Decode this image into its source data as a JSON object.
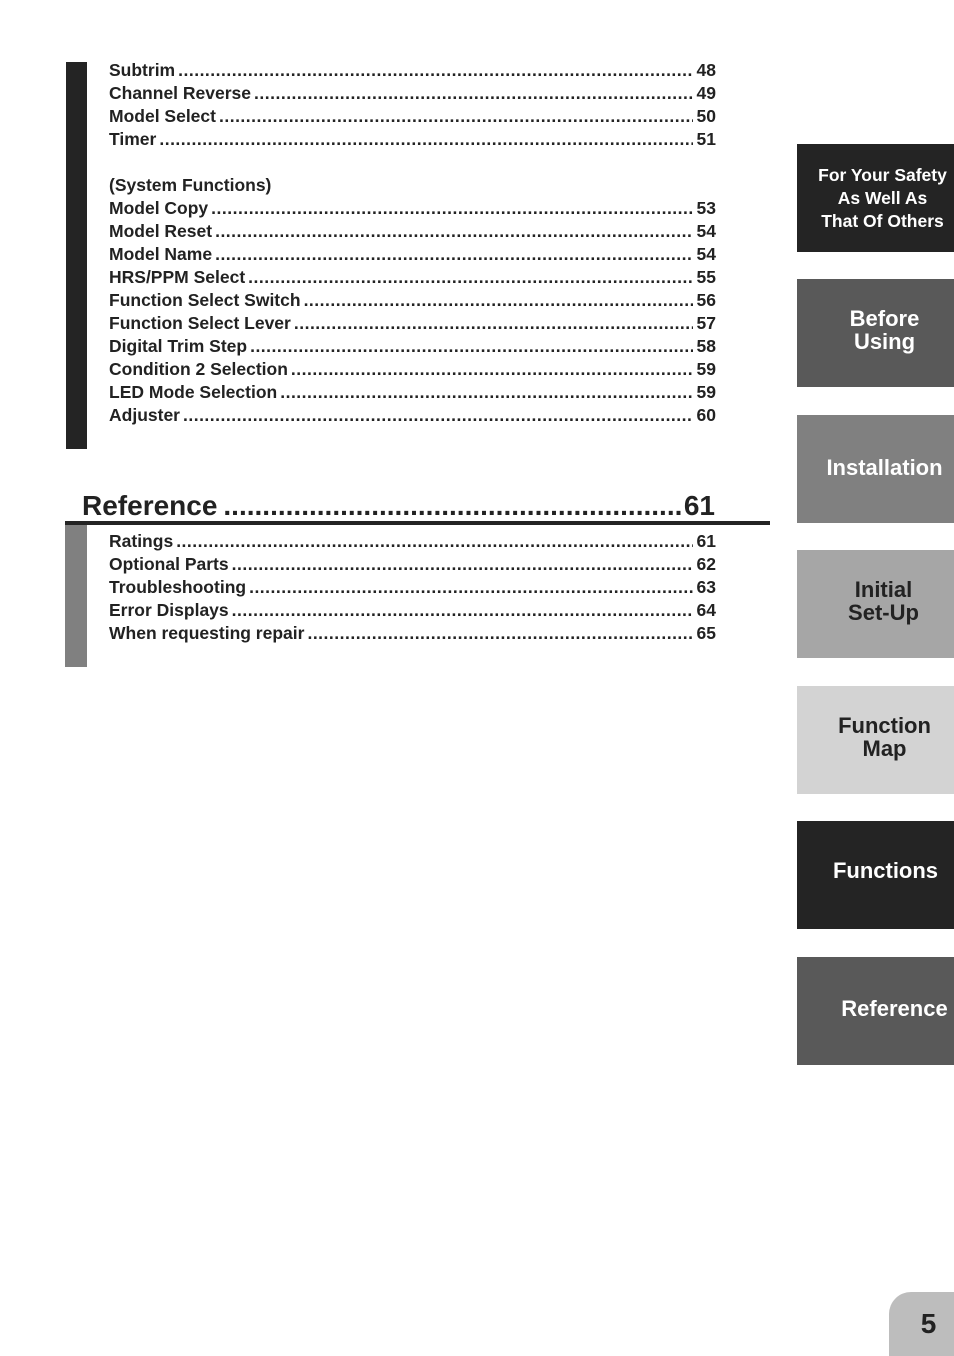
{
  "toc_functions": {
    "items_a": [
      {
        "title": "Subtrim",
        "page": "48"
      },
      {
        "title": "Channel Reverse",
        "page": "49"
      },
      {
        "title": "Model Select",
        "page": "50"
      },
      {
        "title": "Timer",
        "page": "51"
      }
    ],
    "system_heading": "(System Functions)",
    "items_b": [
      {
        "title": "Model Copy",
        "page": "53"
      },
      {
        "title": "Model Reset",
        "page": "54"
      },
      {
        "title": "Model Name",
        "page": "54"
      },
      {
        "title": "HRS/PPM Select",
        "page": "55"
      },
      {
        "title": "Function Select Switch",
        "page": "56"
      },
      {
        "title": "Function Select Lever",
        "page": "57"
      },
      {
        "title": "Digital Trim Step",
        "page": "58"
      },
      {
        "title": "Condition 2 Selection",
        "page": "59"
      },
      {
        "title": "LED Mode Selection",
        "page": "59"
      },
      {
        "title": "Adjuster",
        "page": "60"
      }
    ]
  },
  "section_reference": {
    "title": "Reference",
    "page": "61",
    "items": [
      {
        "title": "Ratings",
        "page": "61"
      },
      {
        "title": "Optional Parts",
        "page": "62"
      },
      {
        "title": "Troubleshooting",
        "page": "63"
      },
      {
        "title": "Error Displays",
        "page": "64"
      },
      {
        "title": "When requesting repair",
        "page": "65"
      }
    ]
  },
  "side_tabs": [
    {
      "lines": [
        "For Your Safety",
        "As Well As",
        "That Of Others"
      ],
      "color": "#242424"
    },
    {
      "lines": [
        "Before",
        "Using"
      ],
      "color": "#595959"
    },
    {
      "lines": [
        "Installation"
      ],
      "color": "#808080"
    },
    {
      "lines": [
        "Initial",
        "Set-Up"
      ],
      "color": "#a6a6a6"
    },
    {
      "lines": [
        "Function",
        "Map"
      ],
      "color": "#d3d3d3"
    },
    {
      "lines": [
        "Functions"
      ],
      "color": "#242424"
    },
    {
      "lines": [
        "Reference"
      ],
      "color": "#595959"
    }
  ],
  "page_number": "5"
}
